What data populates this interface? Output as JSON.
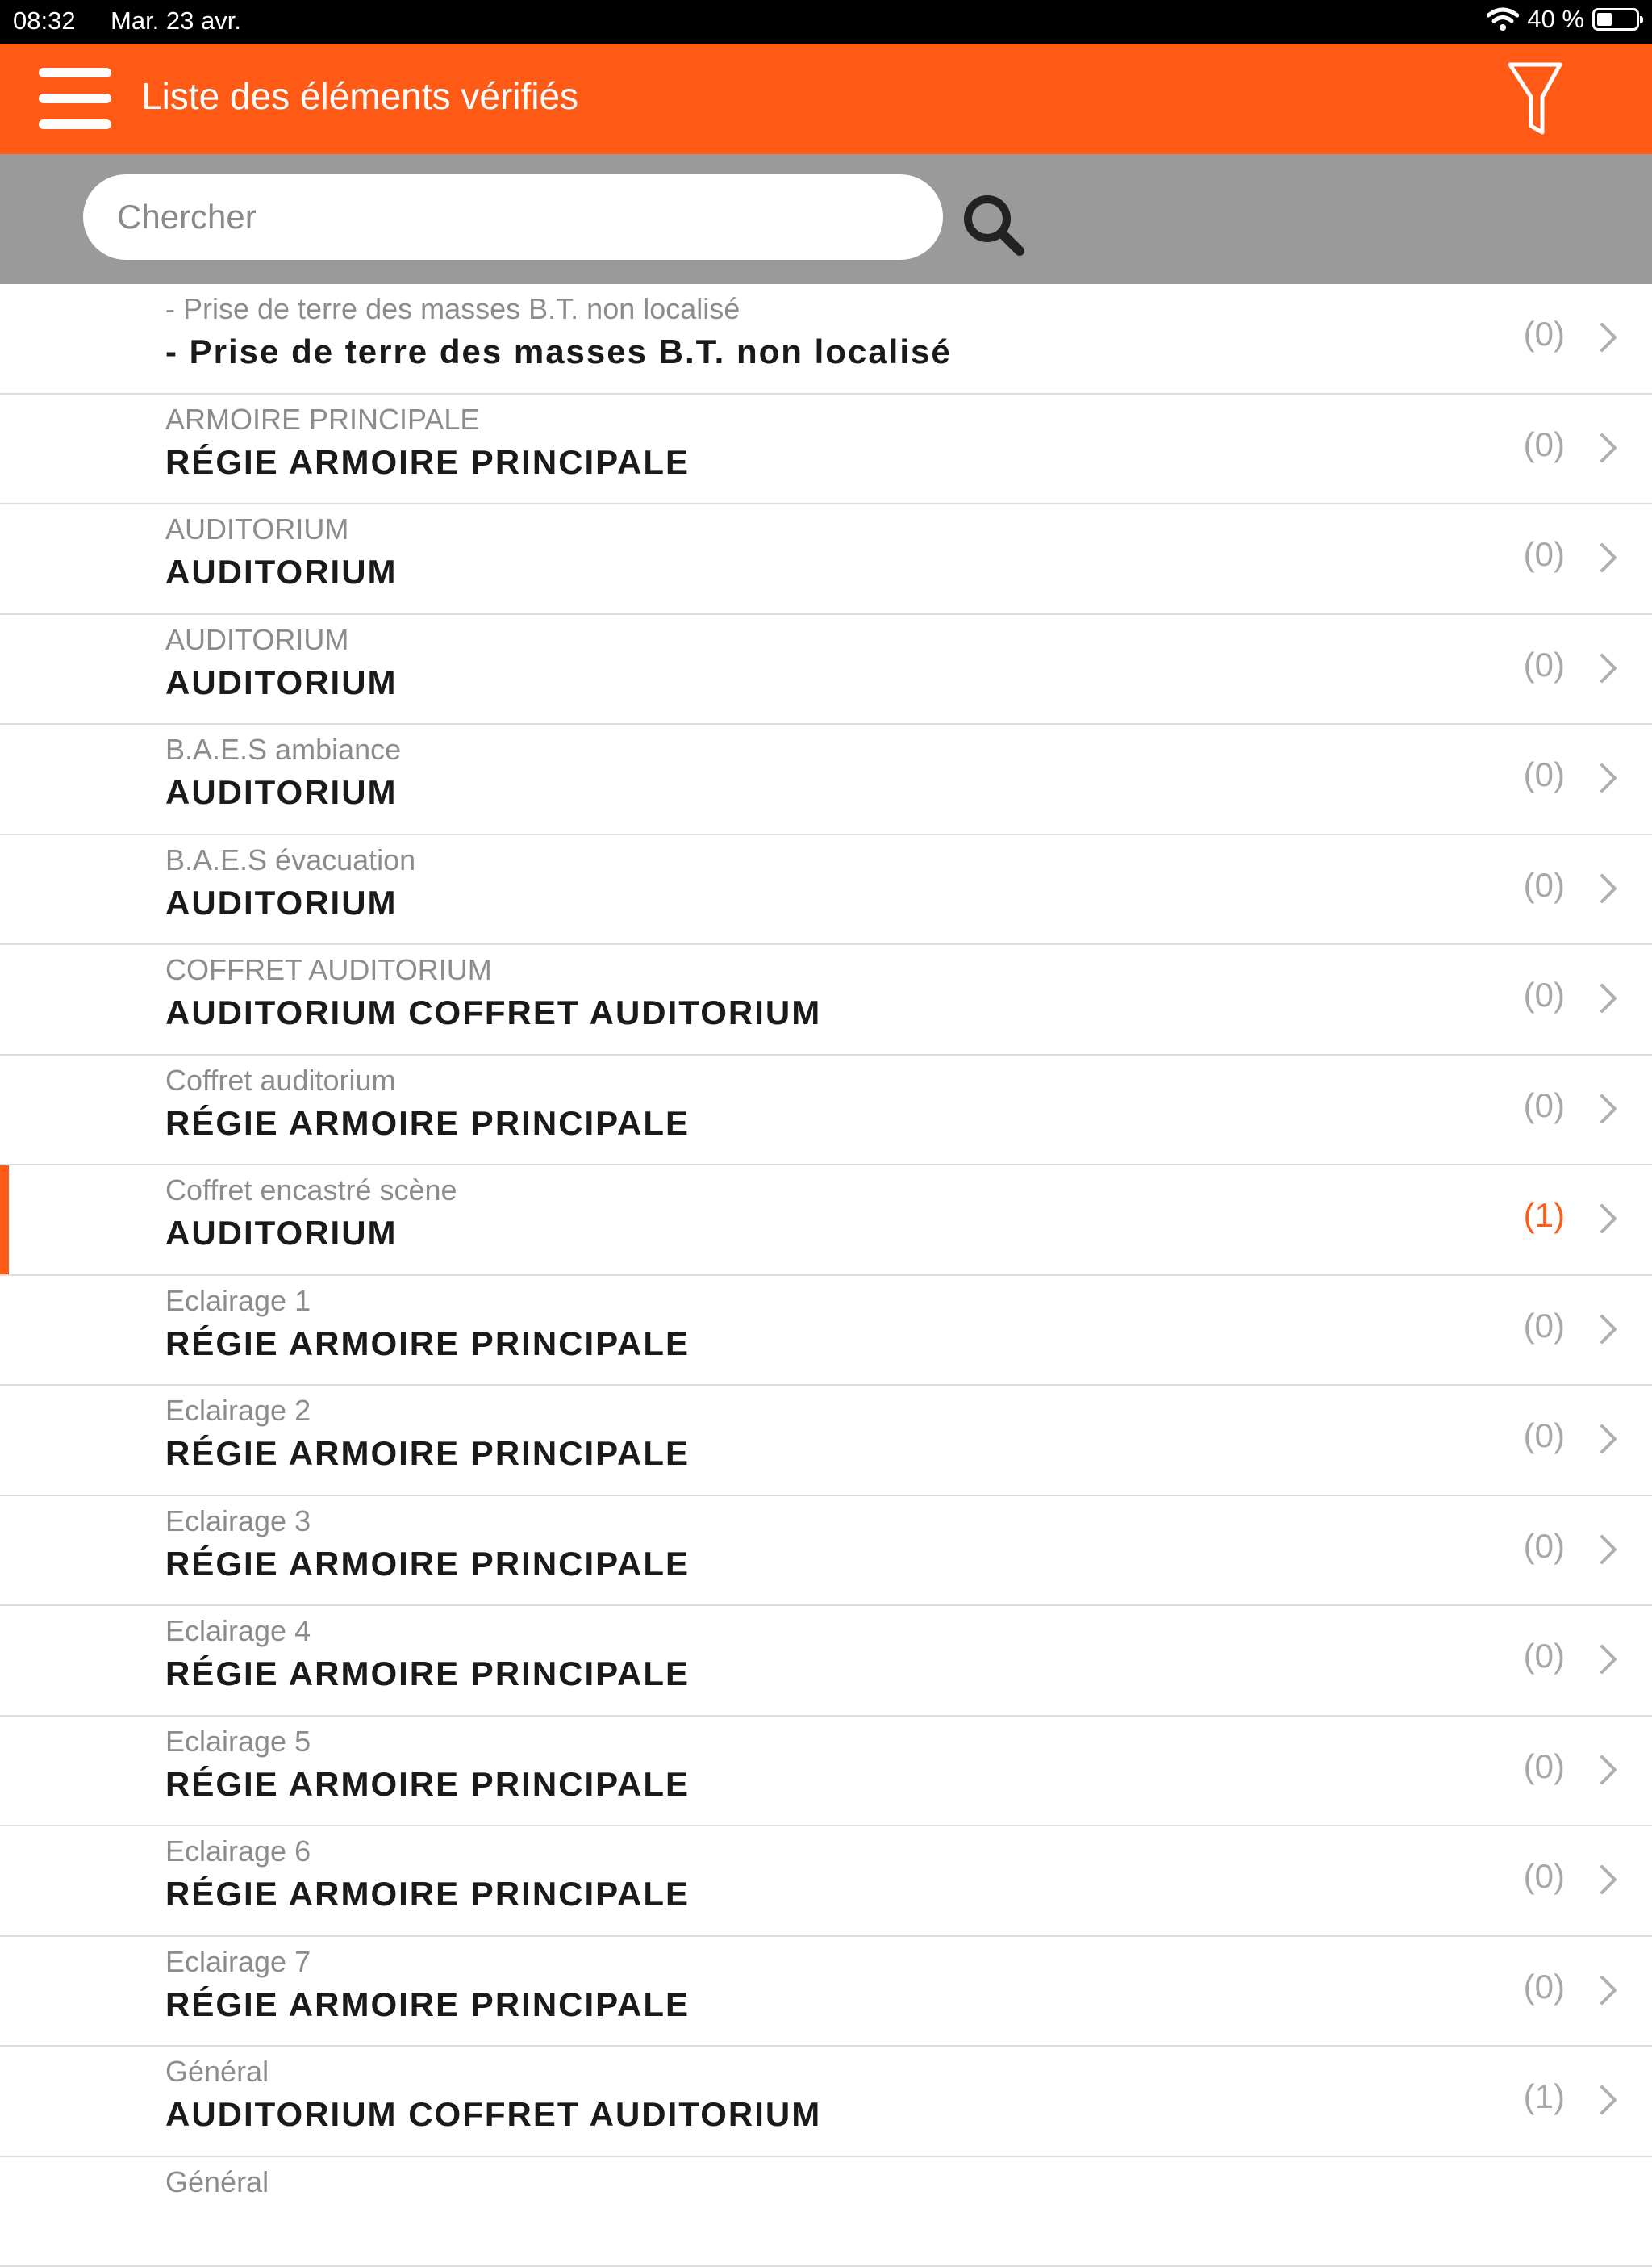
{
  "status_bar": {
    "time": "08:32",
    "date": "Mar. 23 avr.",
    "battery_text": "40 %",
    "battery_level": 0.4
  },
  "header": {
    "title": "Liste des éléments vérifiés",
    "menu_icon": "hamburger-menu-icon",
    "filter_icon": "funnel-filter-icon",
    "accent_color": "#ff5a16"
  },
  "search": {
    "placeholder": "Chercher",
    "value": "",
    "icon": "search-icon"
  },
  "list": {
    "items": [
      {
        "subtitle": "- Prise de terre des masses B.T. non localisé",
        "title": "- Prise de terre des masses B.T. non localisé",
        "count": "(0)"
      },
      {
        "subtitle": "ARMOIRE PRINCIPALE",
        "title": "RÉGIE ARMOIRE PRINCIPALE",
        "count": "(0)"
      },
      {
        "subtitle": "AUDITORIUM",
        "title": "AUDITORIUM",
        "count": "(0)"
      },
      {
        "subtitle": "AUDITORIUM",
        "title": "AUDITORIUM",
        "count": "(0)"
      },
      {
        "subtitle": "B.A.E.S ambiance",
        "title": "AUDITORIUM",
        "count": "(0)"
      },
      {
        "subtitle": "B.A.E.S évacuation",
        "title": "AUDITORIUM",
        "count": "(0)"
      },
      {
        "subtitle": "COFFRET AUDITORIUM",
        "title": "AUDITORIUM COFFRET AUDITORIUM",
        "count": "(0)"
      },
      {
        "subtitle": "Coffret auditorium",
        "title": "RÉGIE ARMOIRE PRINCIPALE",
        "count": "(0)"
      },
      {
        "subtitle": "Coffret encastré scène",
        "title": "AUDITORIUM",
        "count": "(1)",
        "active": true
      },
      {
        "subtitle": "Eclairage 1",
        "title": "RÉGIE ARMOIRE PRINCIPALE",
        "count": "(0)"
      },
      {
        "subtitle": "Eclairage 2",
        "title": "RÉGIE ARMOIRE PRINCIPALE",
        "count": "(0)"
      },
      {
        "subtitle": "Eclairage 3",
        "title": "RÉGIE ARMOIRE PRINCIPALE",
        "count": "(0)"
      },
      {
        "subtitle": "Eclairage 4",
        "title": "RÉGIE ARMOIRE PRINCIPALE",
        "count": "(0)"
      },
      {
        "subtitle": "Eclairage 5",
        "title": "RÉGIE ARMOIRE PRINCIPALE",
        "count": "(0)"
      },
      {
        "subtitle": "Eclairage 6",
        "title": "RÉGIE ARMOIRE PRINCIPALE",
        "count": "(0)"
      },
      {
        "subtitle": "Eclairage 7",
        "title": "RÉGIE ARMOIRE PRINCIPALE",
        "count": "(0)"
      },
      {
        "subtitle": "Général",
        "title": "AUDITORIUM COFFRET AUDITORIUM",
        "count": "(1)"
      },
      {
        "subtitle": "Général",
        "title": "",
        "count": ""
      }
    ]
  }
}
